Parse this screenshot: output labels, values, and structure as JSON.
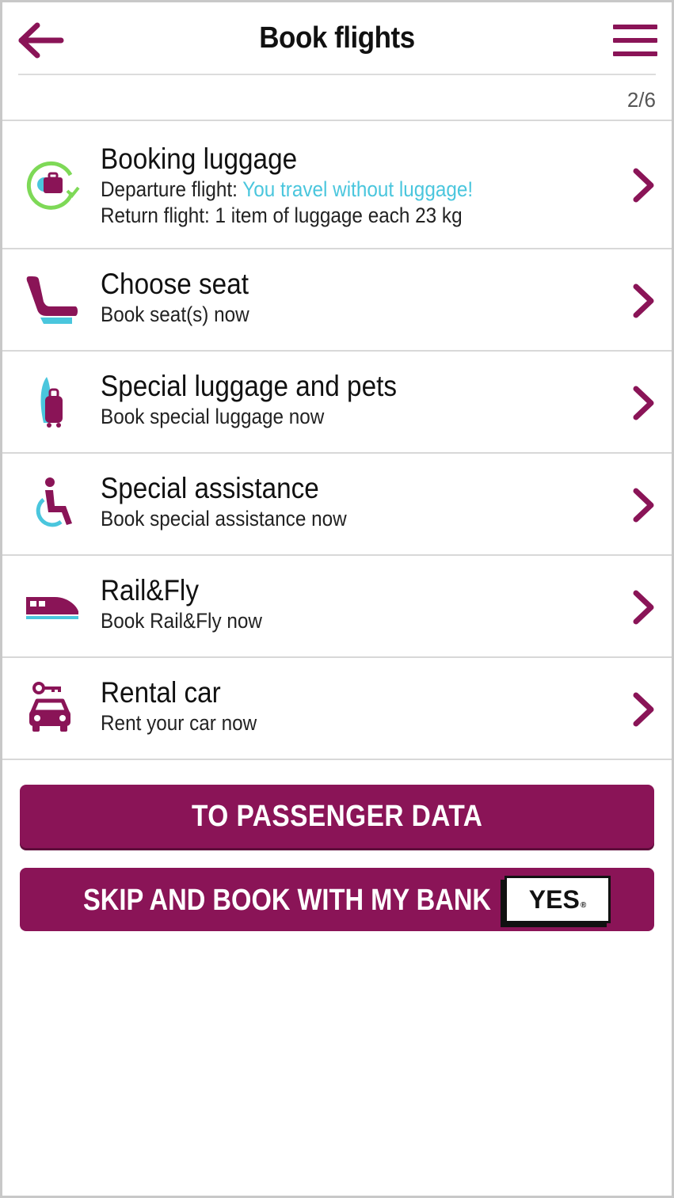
{
  "header": {
    "title": "Book flights",
    "step": "2/6"
  },
  "items": [
    {
      "title": "Booking luggage",
      "line1_prefix": "Departure flight: ",
      "line1_highlight": "You travel without luggage!",
      "line2": "Return flight: 1 item of luggage each 23 kg",
      "icon": "luggage-icon"
    },
    {
      "title": "Choose seat",
      "subtitle": "Book seat(s) now",
      "icon": "seat-icon"
    },
    {
      "title": "Special luggage and pets",
      "subtitle": "Book special luggage now",
      "icon": "special-luggage-icon"
    },
    {
      "title": "Special assistance",
      "subtitle": "Book special assistance now",
      "icon": "wheelchair-icon"
    },
    {
      "title": "Rail&Fly",
      "subtitle": "Book Rail&Fly now",
      "icon": "train-icon"
    },
    {
      "title": "Rental car",
      "subtitle": "Rent your car now",
      "icon": "car-key-icon"
    }
  ],
  "buttons": {
    "primary": "TO PASSENGER DATA",
    "bank": "SKIP AND BOOK WITH MY BANK",
    "bank_badge": "YES",
    "bank_badge_mark": "®"
  },
  "colors": {
    "brand": "#8a1457",
    "highlight": "#4ac6dd"
  }
}
